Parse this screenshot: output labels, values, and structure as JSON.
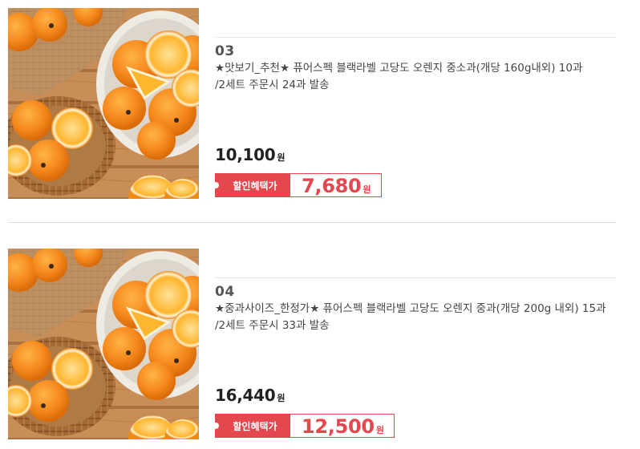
{
  "products": [
    {
      "rank": "03",
      "name": "★맛보기_추천★ 퓨어스펙 블랙라벨 고당도 오렌지 중소과(개당 160g내외) 10과 /2세트 주문시 24과 발송",
      "price": "10,100",
      "price_unit": "원",
      "sale_label": "할인혜택가",
      "sale_price": "7,680",
      "sale_unit": "원"
    },
    {
      "rank": "04",
      "name": "★중과사이즈_한정가★ 퓨어스펙 블랙라벨 고당도 오렌지 중과(개당 200g 내외) 15과 /2세트 주문시 33과 발송",
      "price": "16,440",
      "price_unit": "원",
      "sale_label": "할인혜택가",
      "sale_price": "12,500",
      "sale_unit": "원"
    }
  ],
  "colors": {
    "accent": "#e5474e",
    "price_text": "#222222"
  }
}
